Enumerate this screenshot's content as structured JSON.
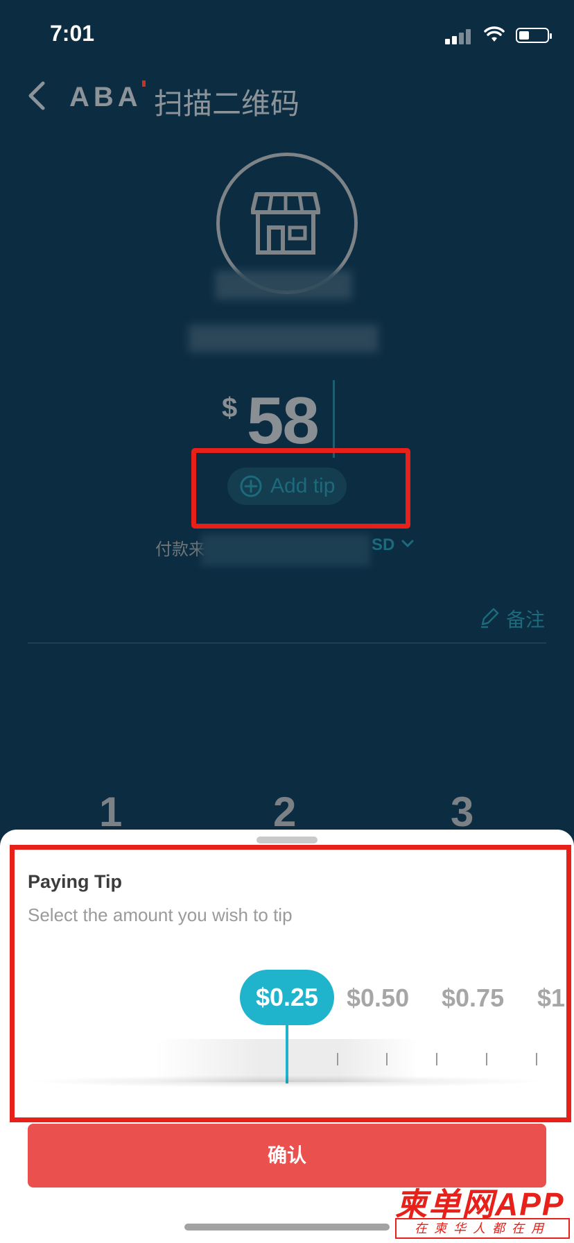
{
  "status_bar": {
    "time": "7:01"
  },
  "nav": {
    "brand": "ABA",
    "title": "扫描二维码"
  },
  "payment": {
    "currency_symbol": "$",
    "amount": "58",
    "add_tip_label": "Add tip"
  },
  "pay_from": {
    "label": "付款来",
    "currency_partial": "SD"
  },
  "note": {
    "label": "备注"
  },
  "keypad": {
    "keys": [
      "1",
      "2",
      "3"
    ]
  },
  "tip_sheet": {
    "title": "Paying Tip",
    "subtitle": "Select the amount you wish to tip",
    "selected": "$0.25",
    "options": [
      "$0.50",
      "$0.75",
      "$1"
    ]
  },
  "confirm_label": "确认",
  "watermark": {
    "main": "柬单网APP",
    "sub": "在柬华人都在用"
  },
  "colors": {
    "accent": "#1fb3cc",
    "confirm": "#e9504e",
    "background": "#0c2c42",
    "highlight": "#e8201a"
  }
}
